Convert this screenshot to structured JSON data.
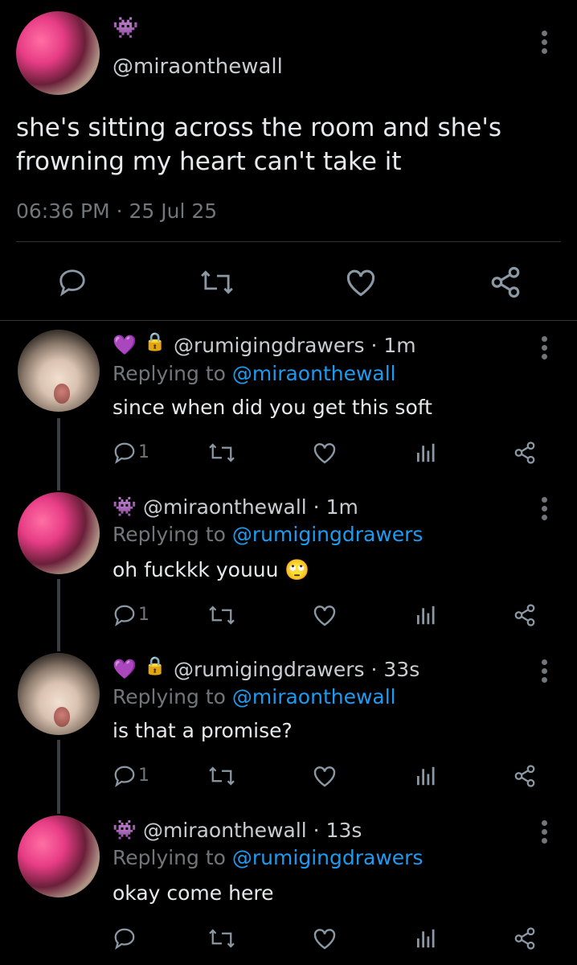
{
  "main_tweet": {
    "handle": "@miraonthewall",
    "name_emoji": "👾",
    "text_line1": "she's sitting across the room and she's",
    "text_line2": "frowning my heart can't take it",
    "timestamp": "06:36 PM · 25 Jul 25"
  },
  "replies": [
    {
      "handle": "@rumigingdrawers · 1m",
      "reply_prefix": "Replying to",
      "reply_to": "@miraonthewall",
      "text": "since when did you get this soft",
      "reply_count": "1"
    },
    {
      "handle": "@miraonthewall · 1m",
      "reply_prefix": "Replying to",
      "reply_to": "@rumigingdrawers",
      "text": "oh fuckkk youuu 🙄",
      "reply_count": "1"
    },
    {
      "handle": "@rumigingdrawers · 33s",
      "reply_prefix": "Replying to",
      "reply_to": "@miraonthewall",
      "text": "is that a promise?",
      "reply_count": "1"
    },
    {
      "handle": "@miraonthewall · 13s",
      "reply_prefix": "Replying to",
      "reply_to": "@rumigingdrawers",
      "text": "okay come here",
      "reply_count": ""
    }
  ],
  "badges": {
    "heart_emoji": "💜",
    "lock_emoji": "🔒",
    "alien_emoji": "👾"
  },
  "colors": {
    "background": "#000000",
    "text": "#e7e9ea",
    "muted": "#71767b",
    "link": "#1d9bf0"
  }
}
